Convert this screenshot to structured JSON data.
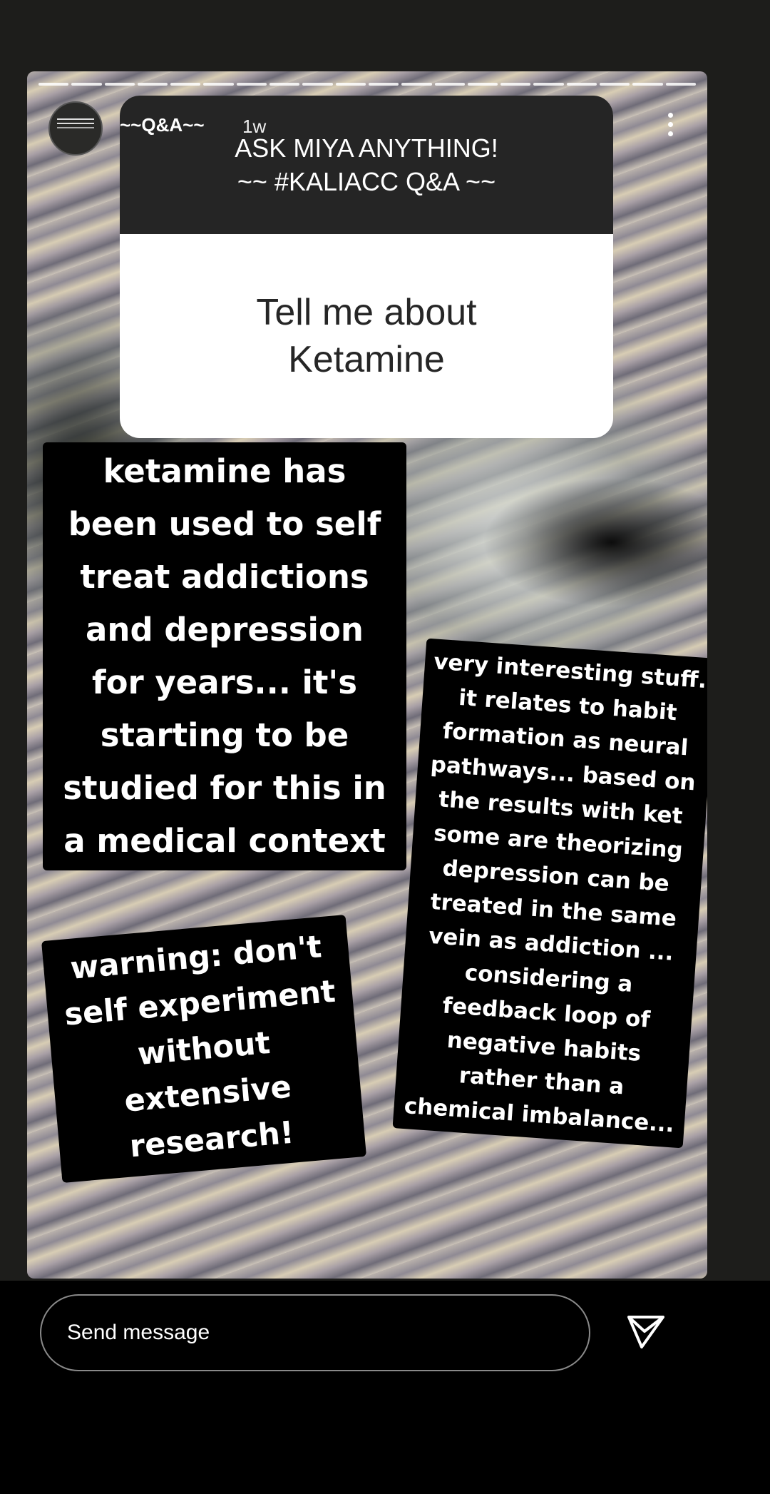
{
  "story": {
    "username": "~~Q&A~~",
    "time": "1w",
    "segments": 20
  },
  "qa_card": {
    "header_line1": "ASK MIYA ANYTHING!",
    "header_line2": "~~ #KALIACC Q&A ~~",
    "question": "Tell me about\nKetamine"
  },
  "stickers": {
    "main": "ketamine has\nbeen used to self\ntreat addictions\nand depression\nfor years... it's\nstarting to be\nstudied for this in\na medical context",
    "right": "very interesting stuff.\nit relates to habit\nformation as neural\npathways... based on\nthe results with ket\nsome are theorizing\ndepression can be\ntreated in the same\nvein as addiction ...\nconsidering a\nfeedback loop of\nnegative habits\nrather than a\nchemical imbalance...",
    "warning": "warning: don't\nself experiment\nwithout extensive\nresearch!"
  },
  "footer": {
    "message_placeholder": "Send message",
    "send_icon": "send-icon"
  }
}
